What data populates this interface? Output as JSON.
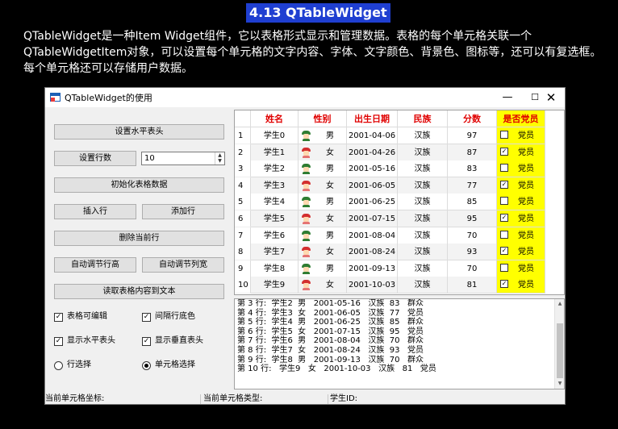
{
  "slide": {
    "title": "4.13 QTableWidget",
    "description": "QTableWidget是一种Item Widget组件，它以表格形式显示和管理数据。表格的每个单元格关联一个QTableWidgetItem对象，可以设置每个单元格的文字内容、字体、文字颜色、背景色、图标等，还可以有复选框。每个单元格还可以存储用户数据。"
  },
  "window": {
    "title": "QTableWidget的使用",
    "min": "—",
    "max": "☐",
    "close": "✕"
  },
  "controls": {
    "set_header_btn": "设置水平表头",
    "set_rows_btn": "设置行数",
    "rows_value": "10",
    "init_data_btn": "初始化表格数据",
    "insert_row_btn": "插入行",
    "add_row_btn": "添加行",
    "delete_row_btn": "删除当前行",
    "auto_row_height_btn": "自动调节行高",
    "auto_col_width_btn": "自动调节列宽",
    "read_to_text_btn": "读取表格内容到文本",
    "editable_label": "表格可编辑",
    "alt_color_label": "间隔行底色",
    "show_h_header_label": "显示水平表头",
    "show_v_header_label": "显示垂直表头",
    "row_select_label": "行选择",
    "cell_select_label": "单元格选择",
    "editable_checked": true,
    "alt_color_checked": true,
    "show_h_header_checked": true,
    "show_v_header_checked": true,
    "selection_mode": "cell"
  },
  "table": {
    "headers": [
      "姓名",
      "性别",
      "出生日期",
      "民族",
      "分数",
      "是否党员"
    ],
    "rows": [
      {
        "num": "1",
        "name": "学生0",
        "gender": "男",
        "gender_icon": "male-icon",
        "birth": "2001-04-06",
        "nation": "汉族",
        "score": "97",
        "party": "党员",
        "checked": false
      },
      {
        "num": "2",
        "name": "学生1",
        "gender": "女",
        "gender_icon": "female-icon",
        "birth": "2001-04-26",
        "nation": "汉族",
        "score": "87",
        "party": "党员",
        "checked": true
      },
      {
        "num": "3",
        "name": "学生2",
        "gender": "男",
        "gender_icon": "male-icon",
        "birth": "2001-05-16",
        "nation": "汉族",
        "score": "83",
        "party": "党员",
        "checked": false
      },
      {
        "num": "4",
        "name": "学生3",
        "gender": "女",
        "gender_icon": "female-icon",
        "birth": "2001-06-05",
        "nation": "汉族",
        "score": "77",
        "party": "党员",
        "checked": true
      },
      {
        "num": "5",
        "name": "学生4",
        "gender": "男",
        "gender_icon": "male-icon",
        "birth": "2001-06-25",
        "nation": "汉族",
        "score": "85",
        "party": "党员",
        "checked": false
      },
      {
        "num": "6",
        "name": "学生5",
        "gender": "女",
        "gender_icon": "female-icon",
        "birth": "2001-07-15",
        "nation": "汉族",
        "score": "95",
        "party": "党员",
        "checked": true
      },
      {
        "num": "7",
        "name": "学生6",
        "gender": "男",
        "gender_icon": "male-icon",
        "birth": "2001-08-04",
        "nation": "汉族",
        "score": "70",
        "party": "党员",
        "checked": false
      },
      {
        "num": "8",
        "name": "学生7",
        "gender": "女",
        "gender_icon": "female-icon",
        "birth": "2001-08-24",
        "nation": "汉族",
        "score": "93",
        "party": "党员",
        "checked": true
      },
      {
        "num": "9",
        "name": "学生8",
        "gender": "男",
        "gender_icon": "male-icon",
        "birth": "2001-09-13",
        "nation": "汉族",
        "score": "70",
        "party": "党员",
        "checked": false
      },
      {
        "num": "10",
        "name": "学生9",
        "gender": "女",
        "gender_icon": "female-icon",
        "birth": "2001-10-03",
        "nation": "汉族",
        "score": "81",
        "party": "党员",
        "checked": true
      }
    ]
  },
  "text_output": {
    "lines": [
      "第 3 行:  学生2  男   2001-05-16   汉族  83   群众",
      "第 4 行:  学生3  女   2001-06-05   汉族  77   党员",
      "第 5 行:  学生4  男   2001-06-25   汉族  85   群众",
      "第 6 行:  学生5  女   2001-07-15   汉族  95   党员",
      "第 7 行:  学生6  男   2001-08-04   汉族  70   群众",
      "第 8 行:  学生7  女   2001-08-24   汉族  93   党员",
      "第 9 行:  学生8  男   2001-09-13   汉族  70   群众",
      "第 10 行:   学生9   女   2001-10-03   汉族   81   党员"
    ]
  },
  "status": {
    "cell_coord": "当前单元格坐标:",
    "cell_type": "当前单元格类型:",
    "student_id": "学生ID:"
  },
  "colors": {
    "header_text": "#e00000",
    "party_bg": "#ffff00",
    "slide_title_bg": "#1f3fd1"
  }
}
